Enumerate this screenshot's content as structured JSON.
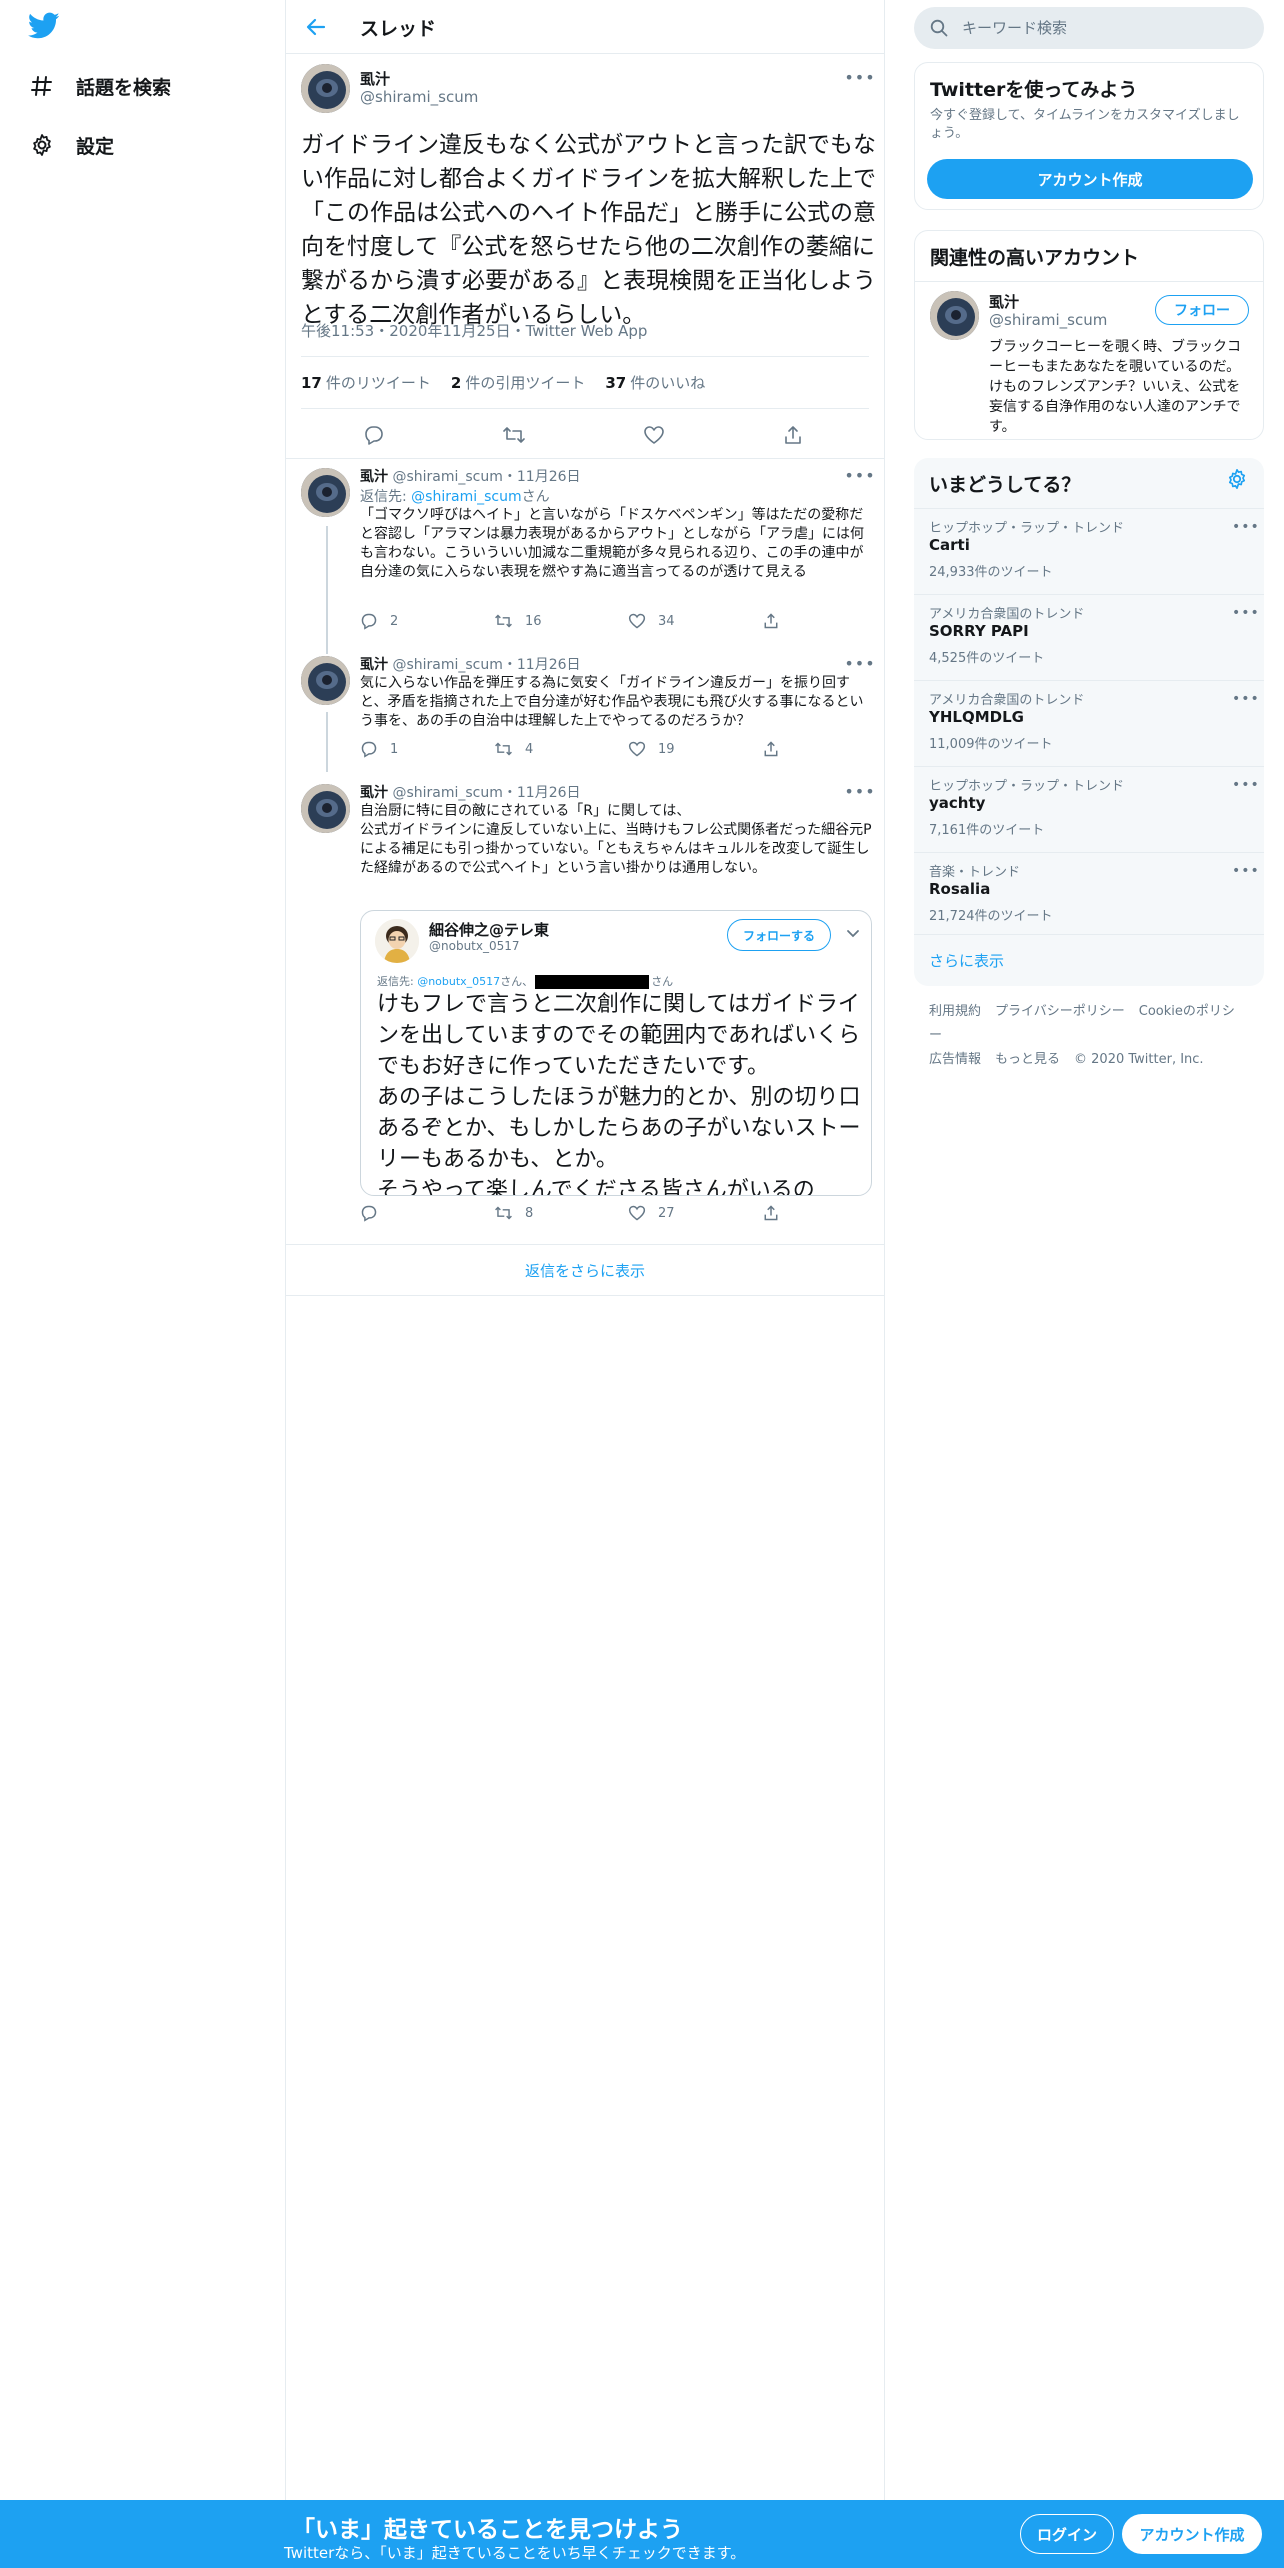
{
  "nav": {
    "items": [
      {
        "label": "話題を検索",
        "icon": "hashtag-icon"
      },
      {
        "label": "設定",
        "icon": "gear-icon"
      }
    ]
  },
  "header": {
    "title": "スレッド"
  },
  "main_tweet": {
    "name": "虱汁",
    "handle": "@shirami_scum",
    "text": "ガイドライン違反もなく公式がアウトと言った訳でもない作品に対し都合よくガイドラインを拡大解釈した上で「この作品は公式へのヘイト作品だ」と勝手に公式の意向を忖度して『公式を怒らせたら他の二次創作の萎縮に繋がるから潰す必要がある』と表現検閲を正当化しようとする二次創作者がいるらしい。",
    "time": "午後11:53・2020年11月25日・",
    "source": "Twitter Web App",
    "retweets": {
      "count": "17",
      "label": "件のリツイート"
    },
    "quotes": {
      "count": "2",
      "label": "件の引用ツイート"
    },
    "likes": {
      "count": "37",
      "label": "件のいいね"
    }
  },
  "replies": [
    {
      "name": "虱汁",
      "handle": "@shirami_scum・11月26日",
      "replyto_prefix": "返信先: ",
      "replyto_link": "@shirami_scum",
      "replyto_suffix": "さん",
      "text": "「ゴマクソ呼びはヘイト」と言いながら「ドスケベペンギン」等はただの愛称だと容認し「アラマンは暴力表現があるからアウト」としながら「アラ虐」には何も言わない。こういういい加減な二重規範が多々見られる辺り、この手の連中が自分達の気に入らない表現を燃やす為に適当言ってるのが透けて見える",
      "replies": "2",
      "retweets": "16",
      "likes": "34"
    },
    {
      "name": "虱汁",
      "handle": "@shirami_scum・11月26日",
      "text": "気に入らない作品を弾圧する為に気安く「ガイドライン違反ガー」を振り回すと、矛盾を指摘された上で自分達が好む作品や表現にも飛び火する事になるという事を、あの手の自治中は理解した上でやってるのだろうか？",
      "replies": "1",
      "retweets": "4",
      "likes": "19"
    },
    {
      "name": "虱汁",
      "handle": "@shirami_scum・11月26日",
      "text": "自治厨に特に目の敵にされている「R」に関しては、\n公式ガイドラインに違反していない上に、当時けもフレ公式関係者だった細谷元Pによる補足にも引っ掛かっていない。「ともえちゃんはキュルルを改変して誕生した経緯があるので公式ヘイト」という言い掛かりは通用しない。",
      "replies": "",
      "retweets": "8",
      "likes": "27",
      "embed": {
        "name": "細谷伸之@テレ東",
        "handle": "@nobutx_0517",
        "follow_label": "フォローする",
        "replyto_prefix": "返信先: ",
        "replyto_link": "@nobutx_0517",
        "replyto_mid": "さん、",
        "replyto_suffix": "さん",
        "text": "けもフレで言うと二次創作に関してはガイドラインを出していますのでその範囲内であればいくらでもお好きに作っていただきたいです。\nあの子はこうしたほうが魅力的とか、別の切り口あるぞとか、もしかしたらあの子がいないストーリーもあるかも、とか。\nそうやって楽しんでくださる皆さんがいるの"
      }
    }
  ],
  "show_more_replies": "返信をさらに表示",
  "search": {
    "placeholder": "キーワード検索"
  },
  "signup_card": {
    "title": "Twitterを使ってみよう",
    "desc": "今すぐ登録して、タイムラインをカスタマイズしましょう。",
    "button": "アカウント作成"
  },
  "related": {
    "title": "関連性の高いアカウント",
    "name": "虱汁",
    "handle": "@shirami_scum",
    "follow": "フォロー",
    "bio": "ブラックコーヒーを覗く時、ブラックコーヒーもまたあなたを覗いているのだ。けものフレンズアンチ？いいえ、公式を妄信する自浄作用のない人達のアンチです。"
  },
  "trends": {
    "title": "いまどうしてる？",
    "items": [
      {
        "category": "ヒップホップ・ラップ・トレンド",
        "name": "Carti",
        "count": "24,933件のツイート"
      },
      {
        "category": "アメリカ合衆国のトレンド",
        "name": "SORRY PAPI",
        "count": "4,525件のツイート"
      },
      {
        "category": "アメリカ合衆国のトレンド",
        "name": "YHLQMDLG",
        "count": "11,009件のツイート"
      },
      {
        "category": "ヒップホップ・ラップ・トレンド",
        "name": "yachty",
        "count": "7,161件のツイート"
      },
      {
        "category": "音楽・トレンド",
        "name": "Rosalia",
        "count": "21,724件のツイート"
      }
    ],
    "show_more": "さらに表示"
  },
  "footer": {
    "links": [
      "利用規約",
      "プライバシーポリシー",
      "Cookieのポリシー",
      "広告情報",
      "もっと見る"
    ],
    "copyright": "© 2020 Twitter, Inc."
  },
  "bottom_bar": {
    "title": "「いま」起きていることを見つけよう",
    "subtitle": "Twitterなら、「いま」起きていることをいち早くチェックできます。",
    "login": "ログイン",
    "signup": "アカウント作成"
  },
  "colors": {
    "accent": "#1da1f2",
    "secondary_text": "#657786",
    "border": "#e6ecf0"
  }
}
